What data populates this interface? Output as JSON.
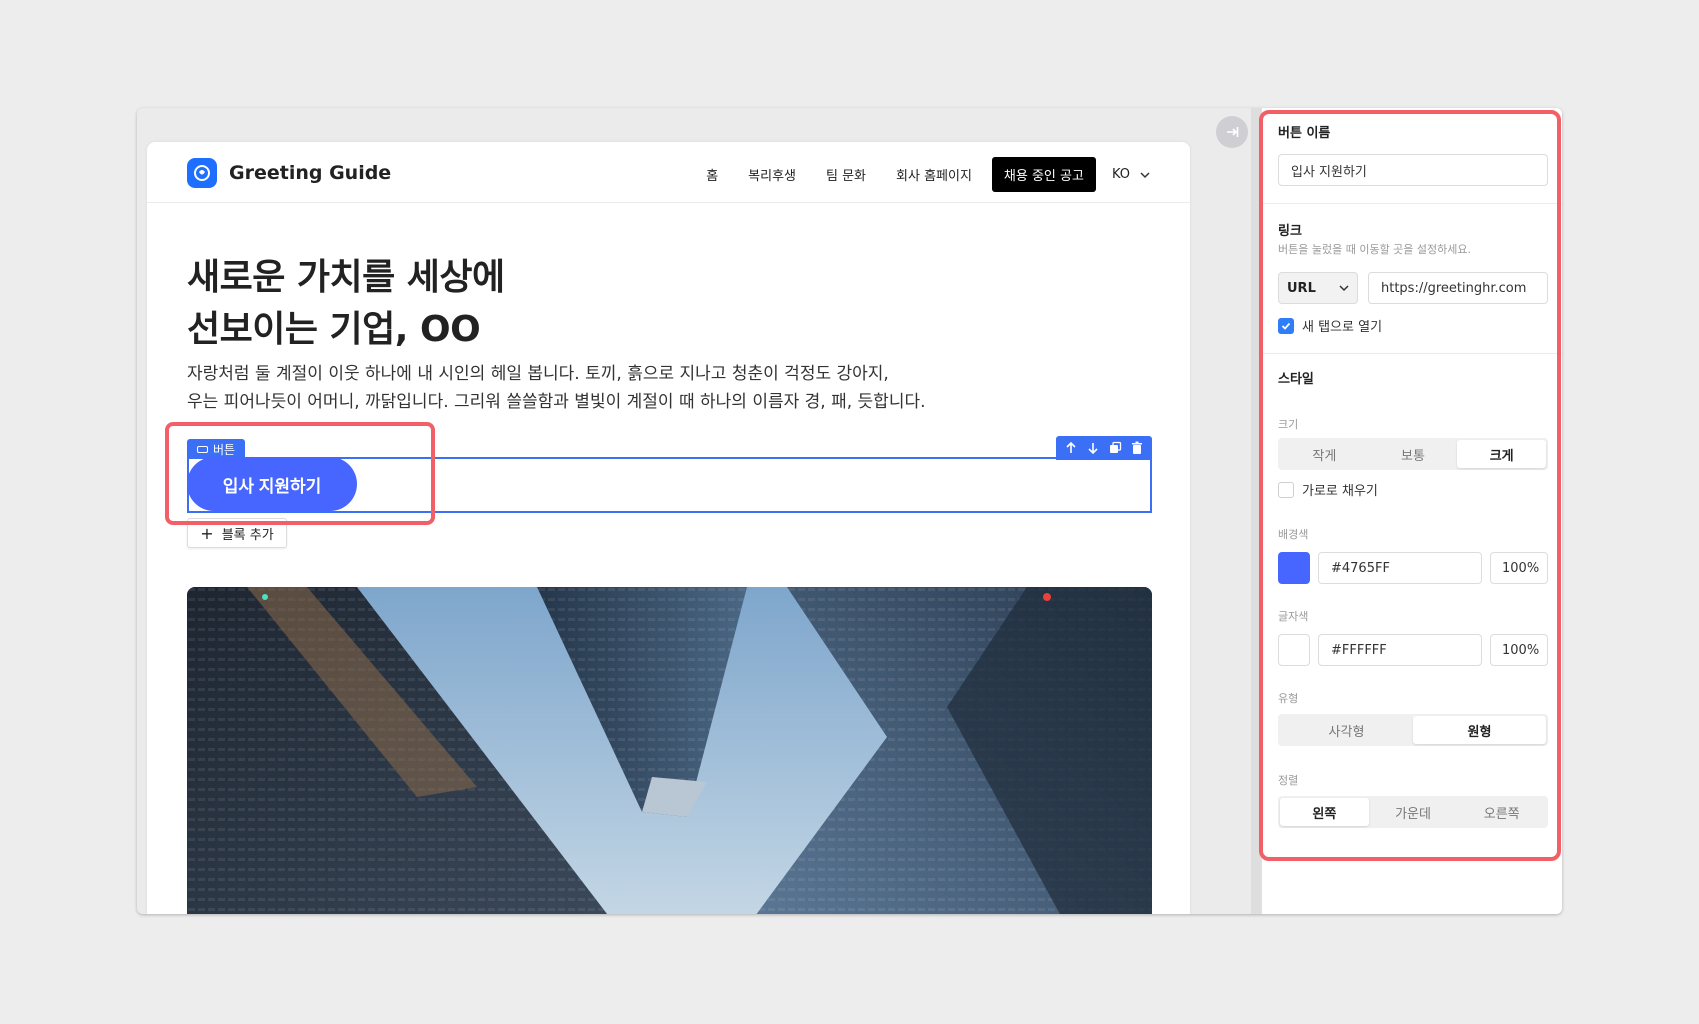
{
  "header": {
    "logo_text": "Greeting Guide",
    "nav": [
      "홈",
      "복리후생",
      "팀 문화",
      "회사 홈페이지"
    ],
    "cta": "채용 중인 공고",
    "lang": "KO"
  },
  "hero": {
    "title_line1": "새로운 가치를 세상에",
    "title_line2": "선보이는 기업, OO",
    "desc_line1": "자랑처럼 둘 계절이 이웃 하나에 내 시인의 헤일 봅니다. 토끼, 흙으로 지나고 청춘이 걱정도 강아지,",
    "desc_line2": "우는 피어나듯이 어머니, 까닭입니다. 그리워 쓸쓸함과 별빛이 계절이 때 하나의 이름자 경, 패, 듯합니다."
  },
  "block": {
    "tag": "버튼",
    "button_label": "입사 지원하기",
    "add_block": "블록 추가"
  },
  "panel": {
    "button_name_label": "버튼 이름",
    "button_name_value": "입사 지원하기",
    "link_label": "링크",
    "link_hint": "버튼을 눌렀을 때 이동할 곳을 설정하세요.",
    "link_type": "URL",
    "link_url": "https://greetinghr.com",
    "new_tab_label": "새 탭으로 열기",
    "new_tab_checked": true,
    "style_label": "스타일",
    "size_label": "크기",
    "size_options": [
      "작게",
      "보통",
      "크게"
    ],
    "size_selected": "크게",
    "fill_width_label": "가로로 채우기",
    "fill_width_checked": false,
    "bg_label": "배경색",
    "bg_color": "#4765FF",
    "bg_opacity": "100%",
    "text_color_label": "글자색",
    "text_color": "#FFFFFF",
    "text_opacity": "100%",
    "shape_label": "유형",
    "shape_options": [
      "사각형",
      "원형"
    ],
    "shape_selected": "원형",
    "align_label": "정렬",
    "align_options": [
      "왼쪽",
      "가운데",
      "오른쪽"
    ],
    "align_selected": "왼쪽"
  },
  "colors": {
    "accent": "#4765FF",
    "selection": "#3B6FF5",
    "highlight": "#F26067"
  }
}
